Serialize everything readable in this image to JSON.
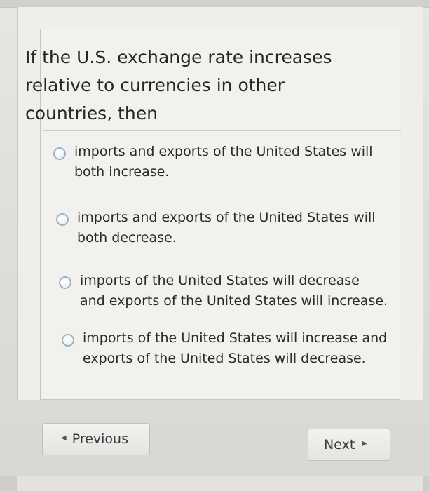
{
  "question": {
    "text": "If the U.S. exchange rate increases relative to currencies in other countries, then"
  },
  "options": [
    {
      "label": "imports and exports of the United States will both increase.",
      "selected": false
    },
    {
      "label": "imports and exports of the United States will both decrease.",
      "selected": false
    },
    {
      "label": "imports of the United States will decrease and exports of the United States will increase.",
      "selected": false
    },
    {
      "label": "imports of the United States will increase and exports of the United States will decrease.",
      "selected": false
    }
  ],
  "navigation": {
    "previous_label": "Previous",
    "next_label": "Next",
    "previous_icon": "triangle-left-icon",
    "next_icon": "triangle-right-icon"
  },
  "colors": {
    "radio_border": "#9fb3c8",
    "text": "#2a2a2a",
    "background": "#efeeeb"
  }
}
